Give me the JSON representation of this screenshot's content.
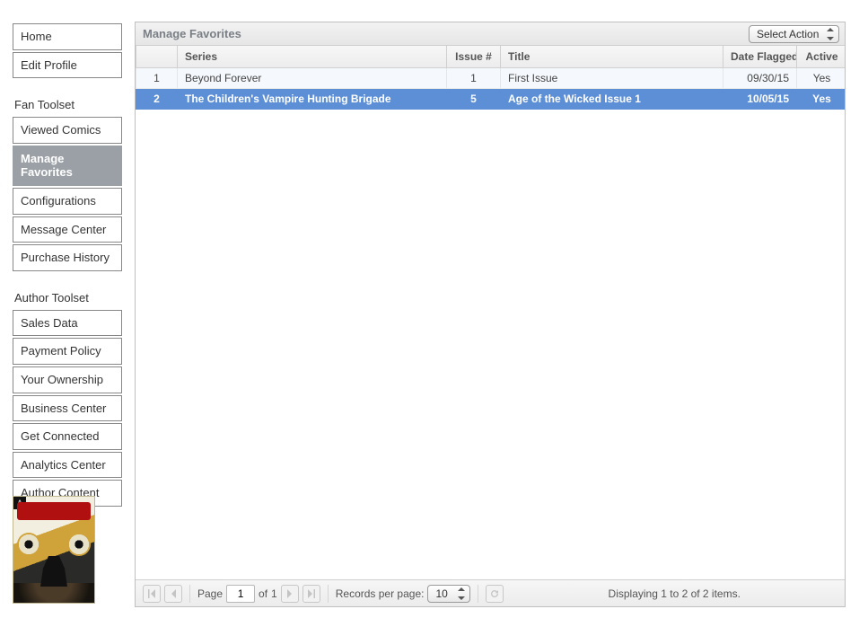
{
  "sidebar": {
    "groups": [
      {
        "title": "",
        "items": [
          {
            "label": "Home",
            "active": false
          },
          {
            "label": "Edit Profile",
            "active": false
          }
        ]
      },
      {
        "title": "Fan Toolset",
        "items": [
          {
            "label": "Viewed Comics",
            "active": false
          },
          {
            "label": "Manage Favorites",
            "active": true
          },
          {
            "label": "Configurations",
            "active": false
          },
          {
            "label": "Message Center",
            "active": false
          },
          {
            "label": "Purchase History",
            "active": false
          }
        ]
      },
      {
        "title": "Author Toolset",
        "items": [
          {
            "label": "Sales Data",
            "active": false
          },
          {
            "label": "Payment Policy",
            "active": false
          },
          {
            "label": "Your Ownership",
            "active": false
          },
          {
            "label": "Business Center",
            "active": false
          },
          {
            "label": "Get Connected",
            "active": false
          },
          {
            "label": "Analytics Center",
            "active": false
          },
          {
            "label": "Author Content",
            "active": false
          }
        ]
      }
    ],
    "thumbnail": {
      "corner": "A"
    }
  },
  "panel": {
    "title": "Manage Favorites",
    "action_select": {
      "selected": "Select Action"
    }
  },
  "grid": {
    "columns": {
      "row_num": "",
      "series": "Series",
      "issue": "Issue #",
      "title": "Title",
      "date_flagged": "Date Flagged",
      "active": "Active"
    },
    "rows": [
      {
        "row_num": "1",
        "series": "Beyond Forever",
        "issue": "1",
        "title": "First Issue",
        "date_flagged": "09/30/15",
        "active": "Yes",
        "selected": false
      },
      {
        "row_num": "2",
        "series": "The Children's Vampire Hunting Brigade",
        "issue": "5",
        "title": "Age of the Wicked Issue 1",
        "date_flagged": "10/05/15",
        "active": "Yes",
        "selected": true
      }
    ]
  },
  "footer": {
    "page_label": "Page",
    "page_value": "1",
    "of_label": "of",
    "total_pages": "1",
    "rpp_label": "Records per page:",
    "rpp_value": "10",
    "status": "Displaying 1 to 2 of 2 items."
  }
}
